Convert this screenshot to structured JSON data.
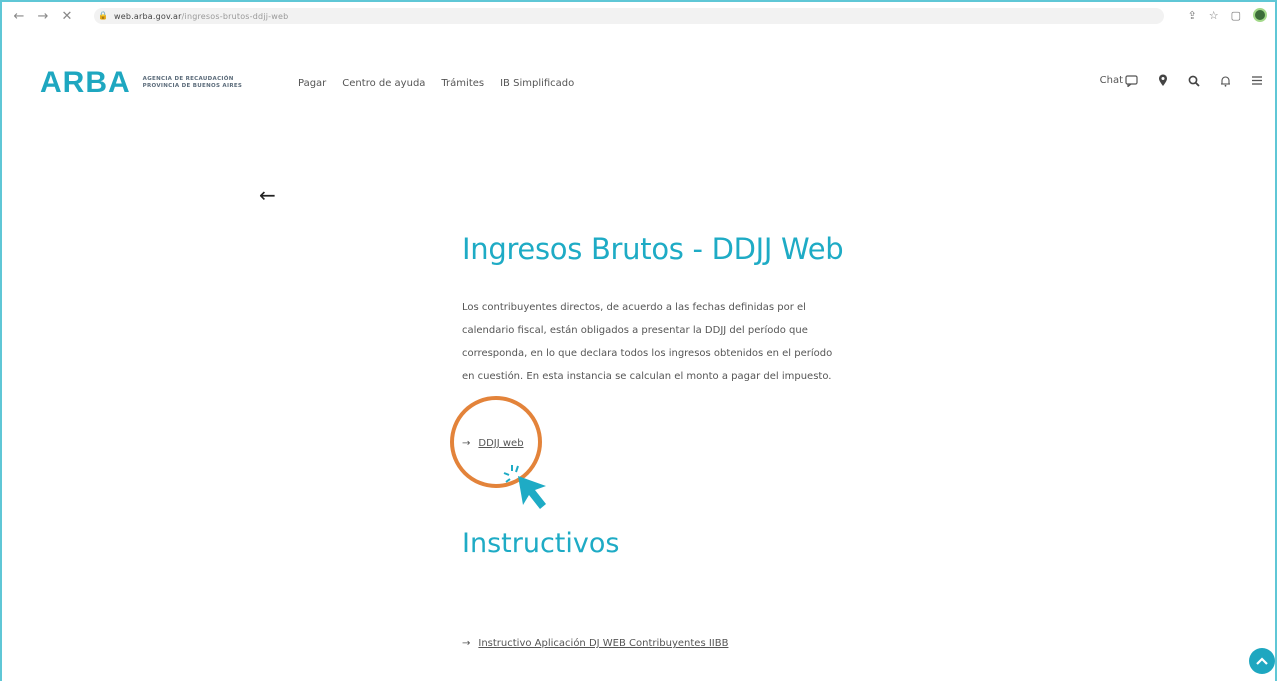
{
  "browser": {
    "url_host": "web.arba.gov.ar",
    "url_path": "/ingresos-brutos-ddjj-web"
  },
  "header": {
    "logo_text": "ARBA",
    "logo_subtitle_line1": "AGENCIA DE RECAUDACIÓN",
    "logo_subtitle_line2": "PROVINCIA DE BUENOS AIRES",
    "menu": [
      "Pagar",
      "Centro de ayuda",
      "Trámites",
      "IB Simplificado"
    ],
    "chat_label": "Chat"
  },
  "main": {
    "title": "Ingresos Brutos - DDJJ Web",
    "paragraph": "Los contribuyentes directos, de acuerdo a las fechas definidas por el calendario fiscal, están obligados a presentar la DDJJ del período que corresponda, en lo que declara todos los ingresos obtenidos en el período en cuestión. En esta instancia se calculan el monto a pagar del impuesto.",
    "link_arrow": "→",
    "link_label": "DDJJ web",
    "instructivos_title": "Instructivos",
    "instructivo_link": "Instructivo Aplicación DJ WEB Contribuyentes IIBB"
  },
  "colors": {
    "brand": "#1ea7c0",
    "highlight_circle": "#e3833a"
  },
  "icons": [
    "back-arrow-icon",
    "chat-icon",
    "location-icon",
    "search-icon",
    "bell-icon",
    "hamburger-icon",
    "cursor-icon",
    "scroll-top-icon"
  ]
}
